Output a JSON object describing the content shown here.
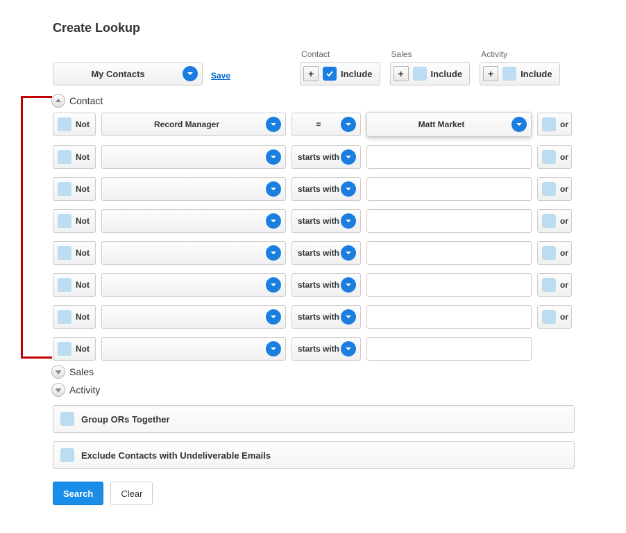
{
  "title": "Create Lookup",
  "set_selector": {
    "label": "My Contacts"
  },
  "save_link": "Save",
  "include_groups": [
    {
      "label": "Contact",
      "include_label": "Include",
      "checked": true
    },
    {
      "label": "Sales",
      "include_label": "Include",
      "checked": false
    },
    {
      "label": "Activity",
      "include_label": "Include",
      "checked": false
    }
  ],
  "sections": {
    "contact": {
      "label": "Contact",
      "expanded": true
    },
    "sales": {
      "label": "Sales",
      "expanded": false
    },
    "activity": {
      "label": "Activity",
      "expanded": false
    }
  },
  "criteria": [
    {
      "not_label": "Not",
      "not_checked": false,
      "field": "Record Manager",
      "op": "=",
      "value_type": "select",
      "value": "Matt Market",
      "has_or": true,
      "or_label": "or",
      "or_checked": false
    },
    {
      "not_label": "Not",
      "not_checked": false,
      "field": "",
      "op": "starts with",
      "value_type": "input",
      "value": "",
      "has_or": true,
      "or_label": "or",
      "or_checked": false
    },
    {
      "not_label": "Not",
      "not_checked": false,
      "field": "",
      "op": "starts with",
      "value_type": "input",
      "value": "",
      "has_or": true,
      "or_label": "or",
      "or_checked": false
    },
    {
      "not_label": "Not",
      "not_checked": false,
      "field": "",
      "op": "starts with",
      "value_type": "input",
      "value": "",
      "has_or": true,
      "or_label": "or",
      "or_checked": false
    },
    {
      "not_label": "Not",
      "not_checked": false,
      "field": "",
      "op": "starts with",
      "value_type": "input",
      "value": "",
      "has_or": true,
      "or_label": "or",
      "or_checked": false
    },
    {
      "not_label": "Not",
      "not_checked": false,
      "field": "",
      "op": "starts with",
      "value_type": "input",
      "value": "",
      "has_or": true,
      "or_label": "or",
      "or_checked": false
    },
    {
      "not_label": "Not",
      "not_checked": false,
      "field": "",
      "op": "starts with",
      "value_type": "input",
      "value": "",
      "has_or": true,
      "or_label": "or",
      "or_checked": false
    },
    {
      "not_label": "Not",
      "not_checked": false,
      "field": "",
      "op": "starts with",
      "value_type": "input",
      "value": "",
      "has_or": false,
      "or_label": "or",
      "or_checked": false
    }
  ],
  "options": {
    "group_ors": {
      "label": "Group ORs Together",
      "checked": false
    },
    "exclude_undeliverable": {
      "label": "Exclude Contacts with Undeliverable Emails",
      "checked": false
    }
  },
  "buttons": {
    "search": "Search",
    "clear": "Clear"
  }
}
